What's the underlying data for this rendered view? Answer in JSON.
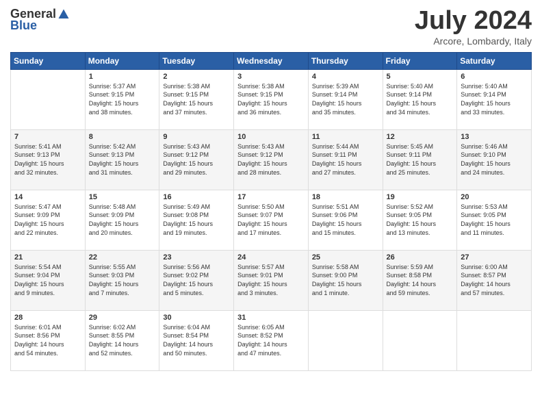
{
  "header": {
    "logo_general": "General",
    "logo_blue": "Blue",
    "month": "July 2024",
    "location": "Arcore, Lombardy, Italy"
  },
  "days_of_week": [
    "Sunday",
    "Monday",
    "Tuesday",
    "Wednesday",
    "Thursday",
    "Friday",
    "Saturday"
  ],
  "weeks": [
    [
      {
        "day": "",
        "info": ""
      },
      {
        "day": "1",
        "info": "Sunrise: 5:37 AM\nSunset: 9:15 PM\nDaylight: 15 hours\nand 38 minutes."
      },
      {
        "day": "2",
        "info": "Sunrise: 5:38 AM\nSunset: 9:15 PM\nDaylight: 15 hours\nand 37 minutes."
      },
      {
        "day": "3",
        "info": "Sunrise: 5:38 AM\nSunset: 9:15 PM\nDaylight: 15 hours\nand 36 minutes."
      },
      {
        "day": "4",
        "info": "Sunrise: 5:39 AM\nSunset: 9:14 PM\nDaylight: 15 hours\nand 35 minutes."
      },
      {
        "day": "5",
        "info": "Sunrise: 5:40 AM\nSunset: 9:14 PM\nDaylight: 15 hours\nand 34 minutes."
      },
      {
        "day": "6",
        "info": "Sunrise: 5:40 AM\nSunset: 9:14 PM\nDaylight: 15 hours\nand 33 minutes."
      }
    ],
    [
      {
        "day": "7",
        "info": "Sunrise: 5:41 AM\nSunset: 9:13 PM\nDaylight: 15 hours\nand 32 minutes."
      },
      {
        "day": "8",
        "info": "Sunrise: 5:42 AM\nSunset: 9:13 PM\nDaylight: 15 hours\nand 31 minutes."
      },
      {
        "day": "9",
        "info": "Sunrise: 5:43 AM\nSunset: 9:12 PM\nDaylight: 15 hours\nand 29 minutes."
      },
      {
        "day": "10",
        "info": "Sunrise: 5:43 AM\nSunset: 9:12 PM\nDaylight: 15 hours\nand 28 minutes."
      },
      {
        "day": "11",
        "info": "Sunrise: 5:44 AM\nSunset: 9:11 PM\nDaylight: 15 hours\nand 27 minutes."
      },
      {
        "day": "12",
        "info": "Sunrise: 5:45 AM\nSunset: 9:11 PM\nDaylight: 15 hours\nand 25 minutes."
      },
      {
        "day": "13",
        "info": "Sunrise: 5:46 AM\nSunset: 9:10 PM\nDaylight: 15 hours\nand 24 minutes."
      }
    ],
    [
      {
        "day": "14",
        "info": "Sunrise: 5:47 AM\nSunset: 9:09 PM\nDaylight: 15 hours\nand 22 minutes."
      },
      {
        "day": "15",
        "info": "Sunrise: 5:48 AM\nSunset: 9:09 PM\nDaylight: 15 hours\nand 20 minutes."
      },
      {
        "day": "16",
        "info": "Sunrise: 5:49 AM\nSunset: 9:08 PM\nDaylight: 15 hours\nand 19 minutes."
      },
      {
        "day": "17",
        "info": "Sunrise: 5:50 AM\nSunset: 9:07 PM\nDaylight: 15 hours\nand 17 minutes."
      },
      {
        "day": "18",
        "info": "Sunrise: 5:51 AM\nSunset: 9:06 PM\nDaylight: 15 hours\nand 15 minutes."
      },
      {
        "day": "19",
        "info": "Sunrise: 5:52 AM\nSunset: 9:05 PM\nDaylight: 15 hours\nand 13 minutes."
      },
      {
        "day": "20",
        "info": "Sunrise: 5:53 AM\nSunset: 9:05 PM\nDaylight: 15 hours\nand 11 minutes."
      }
    ],
    [
      {
        "day": "21",
        "info": "Sunrise: 5:54 AM\nSunset: 9:04 PM\nDaylight: 15 hours\nand 9 minutes."
      },
      {
        "day": "22",
        "info": "Sunrise: 5:55 AM\nSunset: 9:03 PM\nDaylight: 15 hours\nand 7 minutes."
      },
      {
        "day": "23",
        "info": "Sunrise: 5:56 AM\nSunset: 9:02 PM\nDaylight: 15 hours\nand 5 minutes."
      },
      {
        "day": "24",
        "info": "Sunrise: 5:57 AM\nSunset: 9:01 PM\nDaylight: 15 hours\nand 3 minutes."
      },
      {
        "day": "25",
        "info": "Sunrise: 5:58 AM\nSunset: 9:00 PM\nDaylight: 15 hours\nand 1 minute."
      },
      {
        "day": "26",
        "info": "Sunrise: 5:59 AM\nSunset: 8:58 PM\nDaylight: 14 hours\nand 59 minutes."
      },
      {
        "day": "27",
        "info": "Sunrise: 6:00 AM\nSunset: 8:57 PM\nDaylight: 14 hours\nand 57 minutes."
      }
    ],
    [
      {
        "day": "28",
        "info": "Sunrise: 6:01 AM\nSunset: 8:56 PM\nDaylight: 14 hours\nand 54 minutes."
      },
      {
        "day": "29",
        "info": "Sunrise: 6:02 AM\nSunset: 8:55 PM\nDaylight: 14 hours\nand 52 minutes."
      },
      {
        "day": "30",
        "info": "Sunrise: 6:04 AM\nSunset: 8:54 PM\nDaylight: 14 hours\nand 50 minutes."
      },
      {
        "day": "31",
        "info": "Sunrise: 6:05 AM\nSunset: 8:52 PM\nDaylight: 14 hours\nand 47 minutes."
      },
      {
        "day": "",
        "info": ""
      },
      {
        "day": "",
        "info": ""
      },
      {
        "day": "",
        "info": ""
      }
    ]
  ]
}
